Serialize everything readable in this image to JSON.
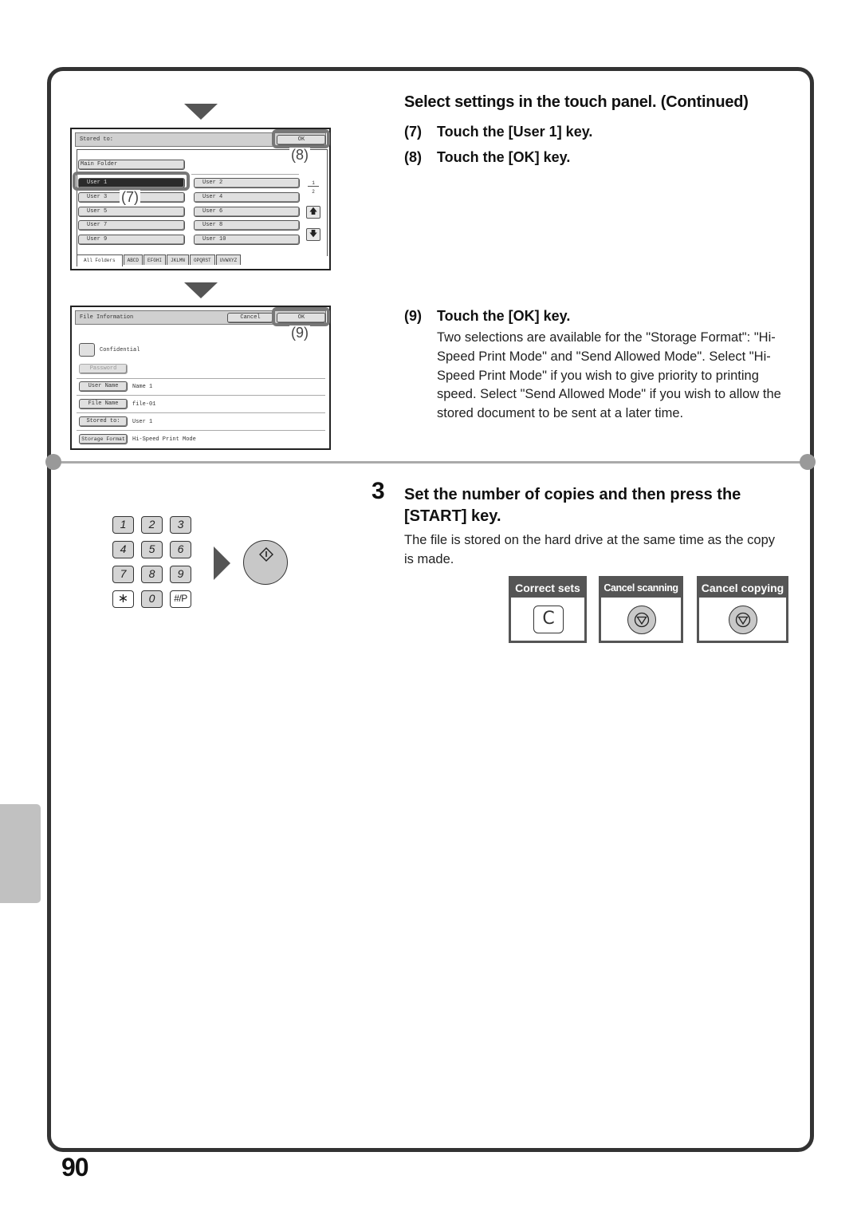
{
  "page": {
    "number": "90"
  },
  "section_continued": {
    "title": "Select settings in the touch panel. (Continued)",
    "steps": [
      {
        "num": "(7)",
        "text": "Touch the [User 1] key."
      },
      {
        "num": "(8)",
        "text": "Touch the [OK] key."
      },
      {
        "num": "(9)",
        "text": "Touch the [OK] key.",
        "description": "Two selections are available for the \"Storage Format\": \"Hi-Speed Print Mode\" and \"Send Allowed Mode\". Select \"Hi-Speed Print Mode\" if you wish to give priority to printing speed. Select \"Send Allowed Mode\" if you wish to allow the stored document to be sent at a later time."
      }
    ]
  },
  "screen_stored_to": {
    "title": "Stored to:",
    "ok_label": "OK",
    "main_folder": "Main Folder",
    "users": [
      "User 1",
      "User 2",
      "User 3",
      "User 4",
      "User 5",
      "User 6",
      "User 7",
      "User 8",
      "User 9",
      "User 10"
    ],
    "selected_user": "User 1",
    "page_current": "1",
    "page_total": "2",
    "tabs": [
      "All Folders",
      "ABCD",
      "EFGHI",
      "JKLMN",
      "OPQRST",
      "UVWXYZ"
    ],
    "callout_user": "(7)",
    "callout_ok": "(8)"
  },
  "screen_file_info": {
    "title": "File Information",
    "cancel_label": "Cancel",
    "ok_label": "OK",
    "confidential_label": "Confidential",
    "password_label": "Password",
    "fields": [
      {
        "label": "User Name",
        "value": "Name 1"
      },
      {
        "label": "File Name",
        "value": "file-01"
      },
      {
        "label": "Stored to:",
        "value": "User 1"
      },
      {
        "label": "Storage Format",
        "value": "Hi-Speed Print Mode"
      }
    ],
    "callout_ok": "(9)"
  },
  "step3": {
    "number": "3",
    "title": "Set the number of copies and then press the [START] key.",
    "description": "The file is stored on the hard drive at the same time as the copy is made."
  },
  "keypad": {
    "keys": [
      "1",
      "2",
      "3",
      "4",
      "5",
      "6",
      "7",
      "8",
      "9",
      "∗",
      "0",
      "#/P"
    ],
    "start_icon": "start-icon"
  },
  "key_boxes": [
    {
      "title": "Correct sets",
      "icon": "clear-key-icon",
      "glyph": "C"
    },
    {
      "title": "Cancel scanning",
      "icon": "stop-icon"
    },
    {
      "title": "Cancel copying",
      "icon": "stop-icon"
    }
  ]
}
